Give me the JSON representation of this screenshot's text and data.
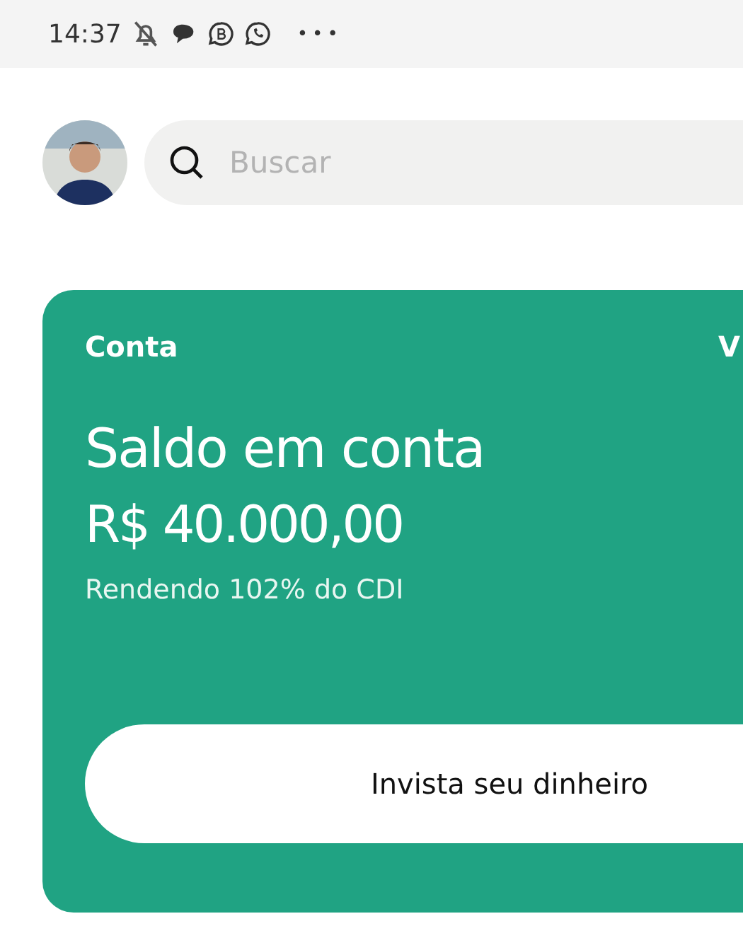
{
  "status_bar": {
    "time": "14:37",
    "more": "•••"
  },
  "search": {
    "placeholder": "Buscar"
  },
  "account_card": {
    "label": "Conta",
    "side_link": "V",
    "title": "Saldo em conta",
    "balance": "R$ 40.000,00",
    "yield_note": "Rendendo 102% do CDI",
    "action": "Invista seu dinheiro"
  }
}
